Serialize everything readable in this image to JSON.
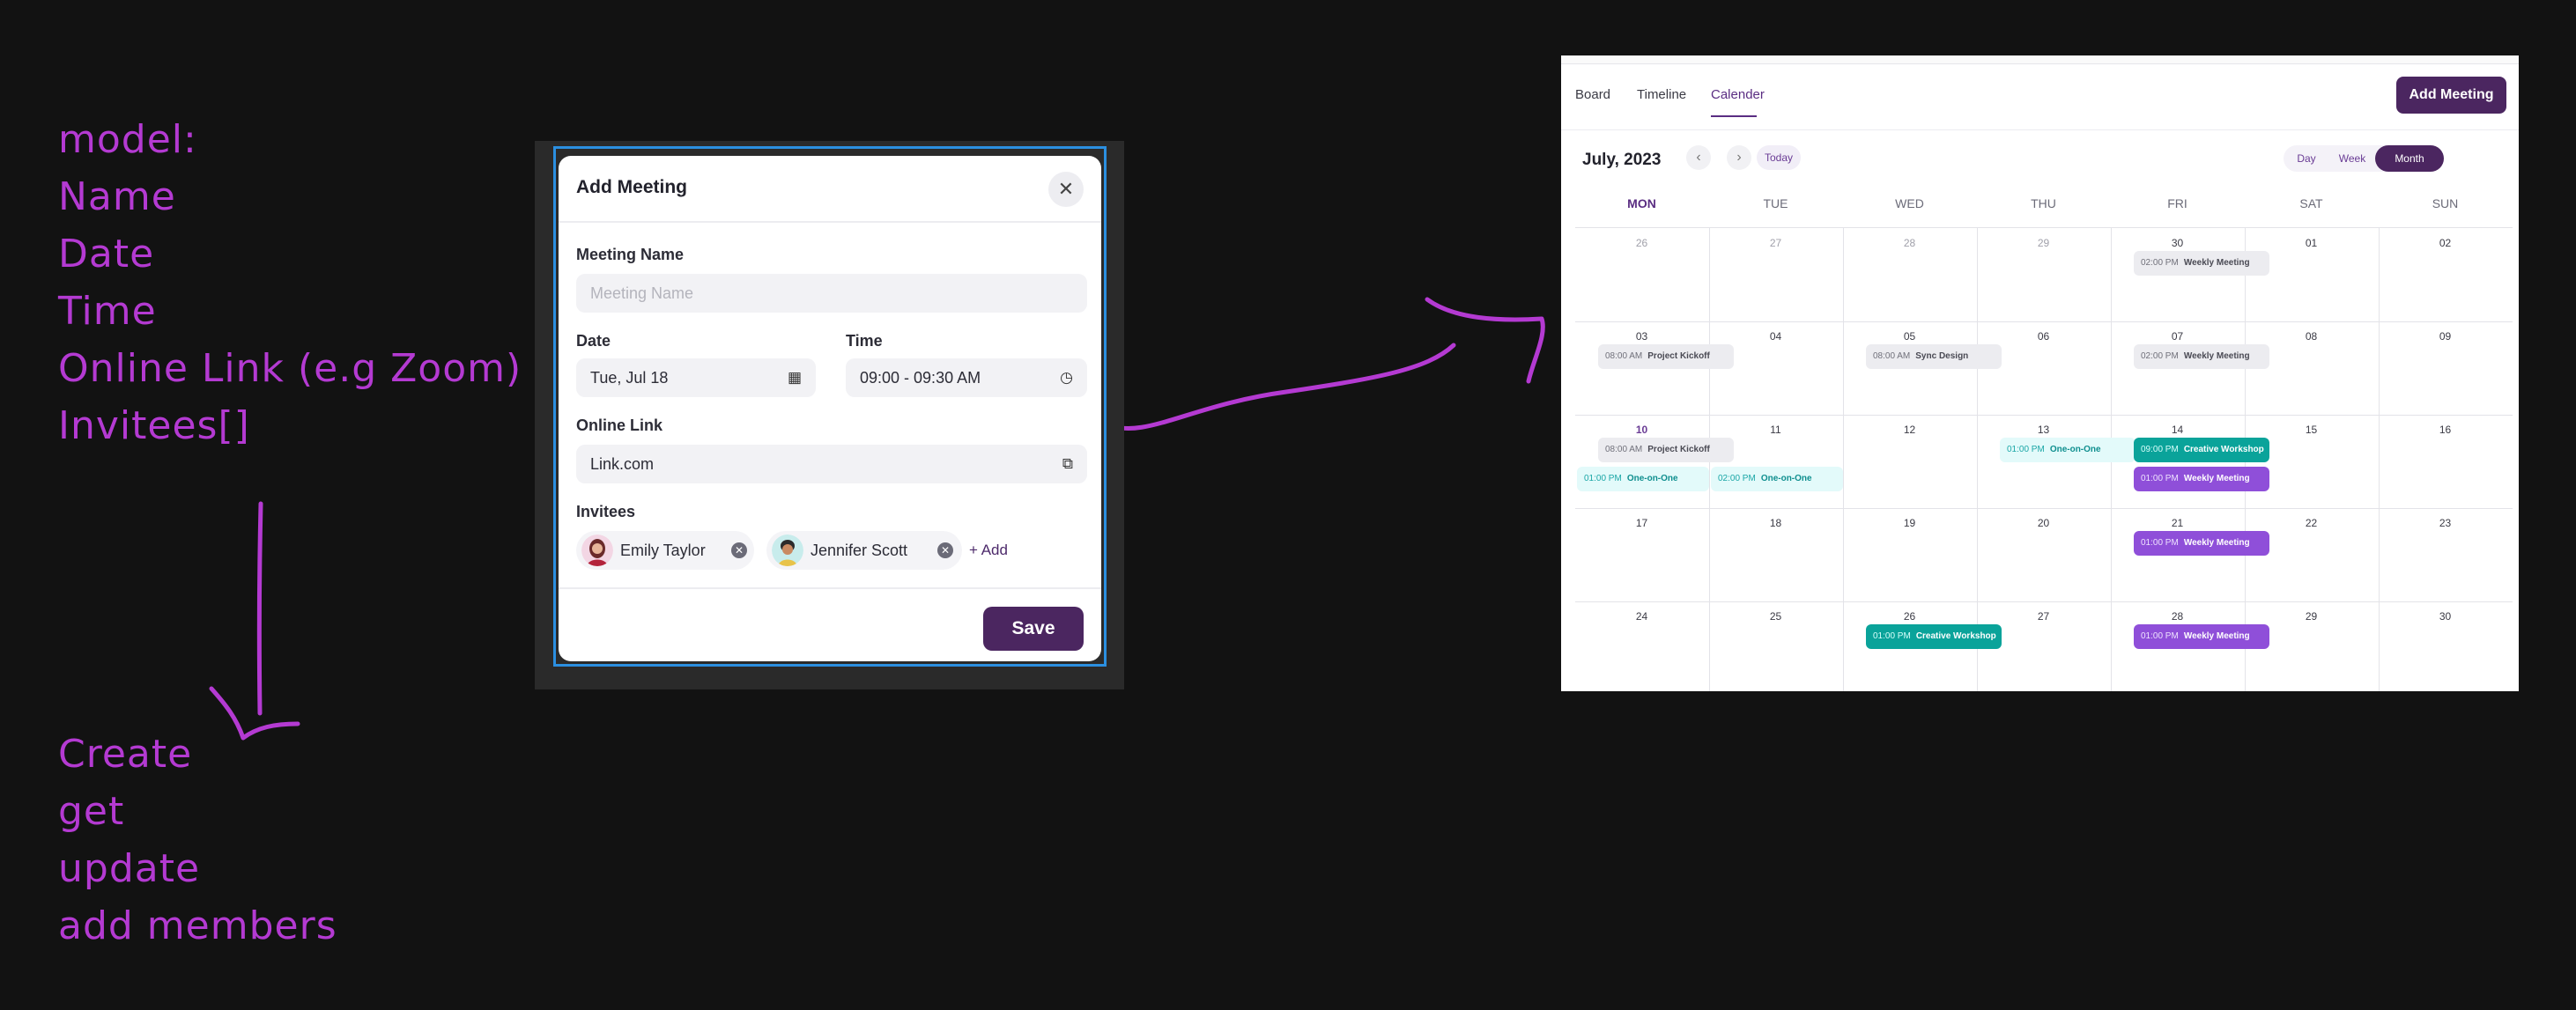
{
  "notes": {
    "model": [
      "model:",
      "Name",
      "Date",
      "Time",
      "Online Link (e.g Zoom)",
      "Invitees[]"
    ],
    "operations": [
      "Create",
      "get",
      "update",
      "add members"
    ]
  },
  "modal": {
    "title": "Add Meeting",
    "close_icon": "close-icon",
    "meeting_name": {
      "label": "Meeting Name",
      "placeholder": "Meeting Name",
      "value": ""
    },
    "date": {
      "label": "Date",
      "value": "Tue,  Jul 18",
      "icon": "calendar-icon"
    },
    "time": {
      "label": "Time",
      "value": "09:00 - 09:30 AM",
      "icon": "clock-icon"
    },
    "online_link": {
      "label": "Online Link",
      "value": "Link.com",
      "icon": "copy-icon"
    },
    "invitees": {
      "label": "Invitees",
      "people": [
        {
          "name": "Emily Taylor"
        },
        {
          "name": "Jennifer Scott"
        }
      ],
      "add_label": "+ Add"
    },
    "save_label": "Save"
  },
  "calendar": {
    "tabs": [
      "Board",
      "Timeline",
      "Calender"
    ],
    "active_tab": "Calender",
    "add_meeting_label": "Add Meeting",
    "month_title": "July, 2023",
    "today_label": "Today",
    "views": [
      "Day",
      "Week",
      "Month"
    ],
    "active_view": "Month",
    "weekdays": [
      "MON",
      "TUE",
      "WED",
      "THU",
      "FRI",
      "SAT",
      "SUN"
    ],
    "weeks": [
      [
        "26",
        "27",
        "28",
        "29",
        "30",
        "01",
        "02"
      ],
      [
        "03",
        "04",
        "05",
        "06",
        "07",
        "08",
        "09"
      ],
      [
        "10",
        "11",
        "12",
        "13",
        "14",
        "15",
        "16"
      ],
      [
        "17",
        "18",
        "19",
        "20",
        "21",
        "22",
        "23"
      ],
      [
        "24",
        "25",
        "26",
        "27",
        "28",
        "29",
        "30"
      ]
    ],
    "muted_days": [
      [
        0,
        0
      ],
      [
        0,
        1
      ],
      [
        0,
        2
      ],
      [
        0,
        3
      ]
    ],
    "today_cell": [
      2,
      0
    ],
    "events": [
      {
        "week": 0,
        "day": 4,
        "slot": 0,
        "time": "02:00 PM",
        "title": "Weekly Meeting",
        "style": "gray"
      },
      {
        "week": 1,
        "day": 0,
        "slot": 0,
        "time": "08:00 AM",
        "title": "Project Kickoff",
        "style": "gray"
      },
      {
        "week": 1,
        "day": 2,
        "slot": 0,
        "time": "08:00 AM",
        "title": "Sync Design",
        "style": "gray"
      },
      {
        "week": 1,
        "day": 4,
        "slot": 0,
        "time": "02:00 PM",
        "title": "Weekly Meeting",
        "style": "gray"
      },
      {
        "week": 2,
        "day": 0,
        "slot": 0,
        "time": "08:00 AM",
        "title": "Project Kickoff",
        "style": "gray"
      },
      {
        "week": 2,
        "day": 0,
        "slot": 1,
        "time": "01:00 PM",
        "title": "One-on-One",
        "style": "cyan"
      },
      {
        "week": 2,
        "day": 1,
        "slot": 1,
        "time": "02:00 PM",
        "title": "One-on-One",
        "style": "cyan"
      },
      {
        "week": 2,
        "day": 3,
        "slot": 0,
        "time": "01:00 PM",
        "title": "One-on-One",
        "style": "cyan"
      },
      {
        "week": 2,
        "day": 4,
        "slot": 0,
        "time": "09:00 PM",
        "title": "Creative Workshop",
        "style": "teal"
      },
      {
        "week": 2,
        "day": 4,
        "slot": 1,
        "time": "01:00 PM",
        "title": "Weekly Meeting",
        "style": "purple"
      },
      {
        "week": 3,
        "day": 4,
        "slot": 0,
        "time": "01:00 PM",
        "title": "Weekly Meeting",
        "style": "purple"
      },
      {
        "week": 4,
        "day": 2,
        "slot": 0,
        "time": "01:00 PM",
        "title": "Creative Workshop",
        "style": "teal"
      },
      {
        "week": 4,
        "day": 4,
        "slot": 0,
        "time": "01:00 PM",
        "title": "Weekly Meeting",
        "style": "purple"
      }
    ]
  },
  "colors": {
    "annotation": "#b43ad2",
    "brand": "#4b2660",
    "selection": "#2b8fe0",
    "event_teal": "#0aa39a",
    "event_purple": "#8f4fd9"
  }
}
